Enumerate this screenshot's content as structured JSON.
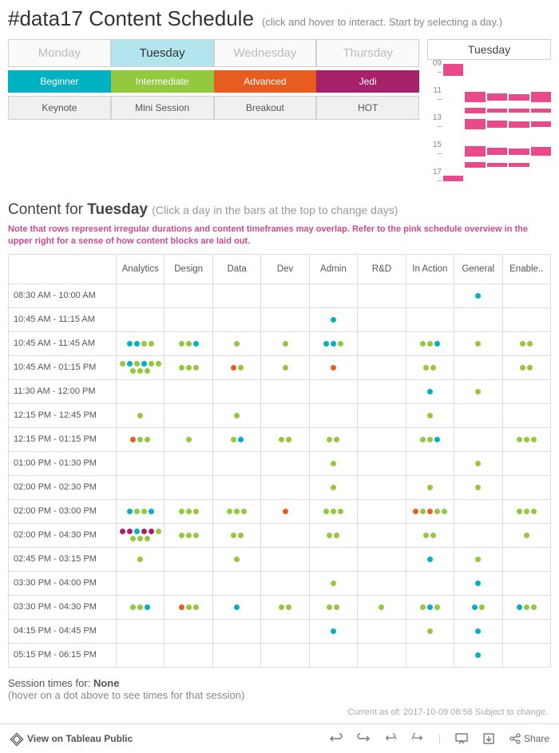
{
  "title": "#data17 Content Schedule",
  "subtitle": "(click and hover to interact. Start by selecting a day.)",
  "days": [
    "Monday",
    "Tuesday",
    "Wednesday",
    "Thursday"
  ],
  "active_day": "Tuesday",
  "levels": [
    {
      "label": "Beginner",
      "color": "#00b2c1"
    },
    {
      "label": "Intermediate",
      "color": "#94c83d"
    },
    {
      "label": "Advanced",
      "color": "#e85d1f"
    },
    {
      "label": "Jedi",
      "color": "#a6206a"
    }
  ],
  "types": [
    "Keynote",
    "Mini Session",
    "Breakout",
    "HOT"
  ],
  "overview": {
    "title": "Tuesday",
    "y_ticks": [
      "09",
      "11",
      "13",
      "15",
      "17"
    ],
    "rows": [
      [
        0.9,
        0,
        0,
        0,
        0
      ],
      [
        0,
        0,
        0,
        0,
        0
      ],
      [
        0,
        0.8,
        0.6,
        0.5,
        0.8
      ],
      [
        0,
        0.4,
        0.3,
        0.3,
        0.3
      ],
      [
        0,
        0.8,
        0.6,
        0.5,
        0.4
      ],
      [
        0,
        0,
        0,
        0,
        0
      ],
      [
        0,
        0.8,
        0.6,
        0.5,
        0.7
      ],
      [
        0,
        0.4,
        0.3,
        0.3,
        0
      ],
      [
        0.4,
        0,
        0,
        0,
        0
      ]
    ],
    "color": "#e84a8a"
  },
  "content_header_prefix": "Content for ",
  "content_header_day": "Tuesday",
  "content_header_suffix": " (Click a day in the bars at the top to change days)",
  "note": "Note that rows represent irregular durations and content timeframes may overlap. Refer to the pink schedule overview in the upper right for a sense of how content blocks are laid out.",
  "columns": [
    "Analytics",
    "Design",
    "Data",
    "Dev",
    "Admin",
    "R&D",
    "In Action",
    "General",
    "Enable.."
  ],
  "colors": {
    "b": "#00b2c1",
    "i": "#94c83d",
    "a": "#e85d1f",
    "j": "#a6206a"
  },
  "rows": [
    {
      "time": "08:30 AM - 10:00 AM",
      "cells": [
        [],
        [],
        [],
        [],
        [],
        [],
        [],
        [
          "b"
        ],
        []
      ]
    },
    {
      "time": "10:45 AM - 11:15 AM",
      "cells": [
        [],
        [],
        [],
        [],
        [
          "b"
        ],
        [],
        [],
        [],
        []
      ]
    },
    {
      "time": "10:45 AM - 11:45 AM",
      "cells": [
        [
          "b",
          "b",
          "i",
          "i"
        ],
        [
          "i",
          "i",
          "b"
        ],
        [
          "i"
        ],
        [
          "i"
        ],
        [
          "b",
          "b",
          "i"
        ],
        [],
        [
          "i",
          "i",
          "b"
        ],
        [
          "i"
        ],
        [
          "i",
          "i"
        ]
      ]
    },
    {
      "time": "10:45 AM - 01:15 PM",
      "cells": [
        [
          "i",
          "b",
          "i",
          "b",
          "i",
          "i",
          "i",
          "i",
          "i"
        ],
        [
          "i",
          "i",
          "i"
        ],
        [
          "a",
          "i"
        ],
        [
          "i"
        ],
        [
          "a"
        ],
        [],
        [
          "i",
          "i"
        ],
        [],
        [
          "i",
          "i"
        ]
      ]
    },
    {
      "time": "11:30 AM - 12:00 PM",
      "cells": [
        [],
        [],
        [],
        [],
        [],
        [],
        [
          "b"
        ],
        [
          "i"
        ],
        []
      ]
    },
    {
      "time": "12:15 PM - 12:45 PM",
      "cells": [
        [
          "i"
        ],
        [],
        [
          "i"
        ],
        [],
        [],
        [],
        [
          "i"
        ],
        [],
        []
      ]
    },
    {
      "time": "12:15 PM - 01:15 PM",
      "cells": [
        [
          "a",
          "i",
          "i"
        ],
        [
          "i"
        ],
        [
          "i",
          "b"
        ],
        [
          "i",
          "i"
        ],
        [
          "i",
          "i"
        ],
        [],
        [
          "i",
          "i",
          "b"
        ],
        [],
        [
          "i",
          "i",
          "i"
        ]
      ]
    },
    {
      "time": "01:00 PM - 01:30 PM",
      "cells": [
        [],
        [],
        [],
        [],
        [
          "i"
        ],
        [],
        [],
        [
          "i"
        ],
        []
      ]
    },
    {
      "time": "02:00 PM - 02:30 PM",
      "cells": [
        [],
        [],
        [],
        [],
        [
          "i"
        ],
        [],
        [
          "i"
        ],
        [
          "i"
        ],
        []
      ]
    },
    {
      "time": "02:00 PM - 03:00 PM",
      "cells": [
        [
          "b",
          "i",
          "i",
          "b"
        ],
        [
          "i",
          "i",
          "i"
        ],
        [
          "i",
          "i",
          "i"
        ],
        [
          "a"
        ],
        [
          "i",
          "i",
          "i"
        ],
        [],
        [
          "a",
          "i",
          "a",
          "i",
          "i"
        ],
        [],
        [
          "i",
          "i",
          "i"
        ]
      ]
    },
    {
      "time": "02:00 PM - 04:30 PM",
      "cells": [
        [
          "j",
          "j",
          "b",
          "j",
          "j",
          "i",
          "i",
          "i",
          "i"
        ],
        [
          "i",
          "i",
          "i"
        ],
        [
          "i",
          "i"
        ],
        [],
        [
          "i",
          "i"
        ],
        [],
        [
          "i",
          "i"
        ],
        [],
        [
          "i"
        ]
      ]
    },
    {
      "time": "02:45 PM - 03:15 PM",
      "cells": [
        [
          "i"
        ],
        [],
        [
          "i"
        ],
        [],
        [],
        [],
        [
          "b"
        ],
        [
          "i"
        ],
        []
      ]
    },
    {
      "time": "03:30 PM - 04:00 PM",
      "cells": [
        [],
        [],
        [],
        [],
        [
          "i"
        ],
        [],
        [],
        [
          "b"
        ],
        []
      ]
    },
    {
      "time": "03:30 PM - 04:30 PM",
      "cells": [
        [
          "i",
          "i",
          "b"
        ],
        [
          "a",
          "i",
          "i"
        ],
        [
          "b"
        ],
        [
          "i",
          "i"
        ],
        [
          "i",
          "i"
        ],
        [
          "i"
        ],
        [
          "i",
          "b",
          "i"
        ],
        [
          "b",
          "i"
        ],
        [
          "b",
          "i",
          "i"
        ]
      ]
    },
    {
      "time": "04:15 PM - 04:45 PM",
      "cells": [
        [],
        [],
        [],
        [],
        [
          "b"
        ],
        [],
        [
          "i"
        ],
        [
          "b"
        ],
        []
      ]
    },
    {
      "time": "05:15 PM - 06:15 PM",
      "cells": [
        [],
        [],
        [],
        [],
        [],
        [],
        [],
        [
          "b"
        ],
        []
      ]
    }
  ],
  "session_label": "Session times for: ",
  "session_value": "None",
  "session_hint": "(hover on a dot above to see times for that session)",
  "footer_note": "Current as of: 2017-10-09 08:56 Subject to change.",
  "toolbar": {
    "view": "View on Tableau Public",
    "share": "Share"
  }
}
